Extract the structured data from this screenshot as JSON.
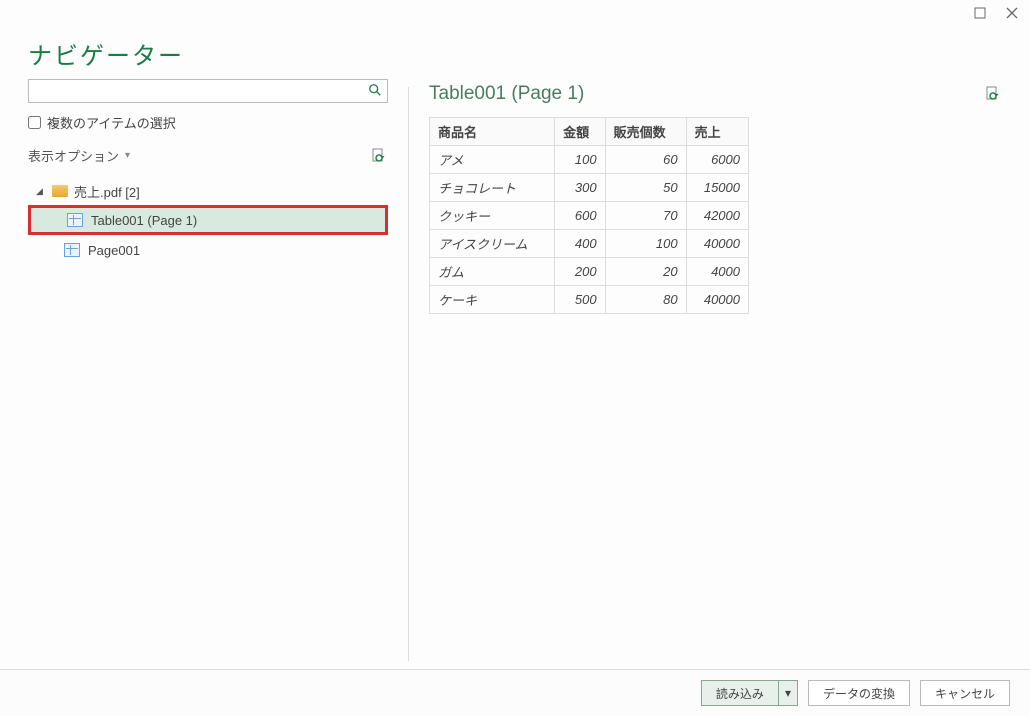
{
  "window": {
    "title": "ナビゲーター"
  },
  "left": {
    "search_placeholder": "",
    "multi_select_label": "複数のアイテムの選択",
    "display_options_label": "表示オプション",
    "tree": {
      "root_label": "売上.pdf [2]",
      "items": [
        {
          "label": "Table001 (Page 1)",
          "selected": true
        },
        {
          "label": "Page001",
          "selected": false
        }
      ]
    }
  },
  "preview": {
    "title": "Table001 (Page 1)",
    "headers": [
      "商品名",
      "金額",
      "販売個数",
      "売上"
    ],
    "rows": [
      [
        "アメ",
        "100",
        "60",
        "6000"
      ],
      [
        "チョコレート",
        "300",
        "50",
        "15000"
      ],
      [
        "クッキー",
        "600",
        "70",
        "42000"
      ],
      [
        "アイスクリーム",
        "400",
        "100",
        "40000"
      ],
      [
        "ガム",
        "200",
        "20",
        "4000"
      ],
      [
        "ケーキ",
        "500",
        "80",
        "40000"
      ]
    ]
  },
  "footer": {
    "load_label": "読み込み",
    "transform_label": "データの変換",
    "cancel_label": "キャンセル"
  }
}
